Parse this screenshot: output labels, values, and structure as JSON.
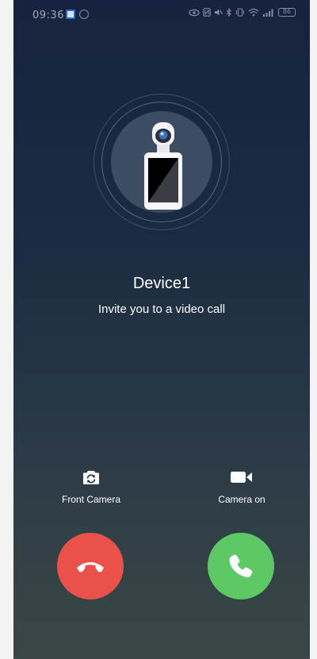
{
  "status_bar": {
    "time": "09:36",
    "battery": "86"
  },
  "call": {
    "caller_name": "Device1",
    "subtitle": "Invite you to a video call"
  },
  "options": {
    "front_camera_label": "Front Camera",
    "camera_on_label": "Camera on"
  },
  "colors": {
    "decline": "#e9514a",
    "accept": "#5cc866"
  },
  "icons": {
    "front_camera": "camera-switch-icon",
    "camera_on": "video-camera-icon",
    "decline": "hang-up-icon",
    "accept": "phone-icon"
  }
}
